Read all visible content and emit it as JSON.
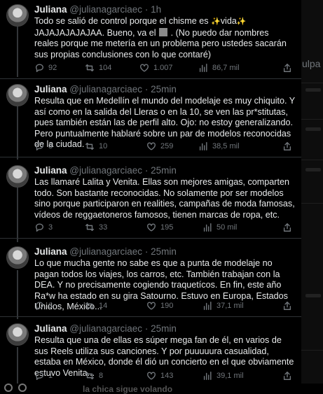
{
  "tweets": [
    {
      "name": "Juliana",
      "handle": "@julianagarciaec",
      "time": "1h",
      "text_pre": "Todo se salió de control porque el chisme es ",
      "emoji_a": "✨",
      "text_mid": "vida",
      "emoji_b": "✨",
      "text_mid2": " JAJAJAJAJAJAA. Bueno, va el ",
      "text_post": " . (No puedo dar nombres reales porque me metería en un problema pero ustedes sacarán sus propias conclusiones con lo que contaré)",
      "replies": "92",
      "retweets": "104",
      "likes": "1.007",
      "views": "86,7 mil"
    },
    {
      "name": "Juliana",
      "handle": "@julianagarciaec",
      "time": "25min",
      "text": "Resulta que en Medellín el mundo del modelaje es muy chiquito. Y así como en la salida del Lleras o en la 10, se ven las pr*stitutas, pues también están las de perfil alto. Ojo: no estoy generalizando. Pero puntualmente hablaré sobre un par de modelos reconocidas de la ciudad.",
      "replies": "3",
      "retweets": "10",
      "likes": "259",
      "views": "38,5 mil"
    },
    {
      "name": "Juliana",
      "handle": "@julianagarciaec",
      "time": "25min",
      "text": "Las llamaré Lalita y Venita. Ellas son mejores amigas, comparten todo. Son bastante reconocidas. No solamente por ser modelos sino porque participaron en realities, campañas de moda famosas, vídeos de reggaetoneros famosos, tienen marcas de ropa, etc.",
      "replies": "3",
      "retweets": "33",
      "likes": "195",
      "views": "50 mil"
    },
    {
      "name": "Juliana",
      "handle": "@julianagarciaec",
      "time": "25min",
      "text": "Lo que mucha gente no sabe es que a punta de modelaje no pagan todos los viajes, los carros, etc. También trabajan con la DEA. Y no precisamente cogiendo traquetícos. En fin, este año Ra*w ha estado en su gira Satourno. Estuvo en Europa, Estados Unidos, México...",
      "replies": "3",
      "retweets": "14",
      "likes": "190",
      "views": "37,1 mil"
    },
    {
      "name": "Juliana",
      "handle": "@julianagarciaec",
      "time": "25min",
      "text": "Resulta que una de ellas es súper mega fan de él, en varios de sus Reels utiliza sus canciones. Y por puuuuura casualidad, estaba en México, donde él dió un concierto en el que obviamente estuvo Venita...",
      "replies": "1",
      "retweets": "8",
      "likes": "143",
      "views": "39,1 mil"
    }
  ],
  "dot": "·",
  "right_panel": {
    "text": "ulpa c"
  },
  "bottom_bar": {
    "name": "la chica sigue volando"
  },
  "colors": {
    "background": "#000000",
    "text": "#e7e9ea",
    "muted": "#71767b",
    "divider": "#2f3336"
  }
}
